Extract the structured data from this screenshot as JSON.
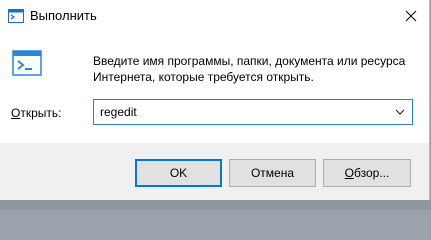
{
  "window": {
    "title": "Выполнить",
    "close_symbol": "✕"
  },
  "dialog": {
    "description_line1": "Введите имя программы, папки, документа или ресурса",
    "description_line2": "Интернета, которые требуется открыть.",
    "open_label_mnemonic": "О",
    "open_label_rest": "ткрыть:",
    "input_value": "regedit"
  },
  "buttons": {
    "ok": "OK",
    "cancel": "Отмена",
    "browse_mnemonic": "О",
    "browse_rest": "бзор..."
  },
  "icons": {
    "title": "run-app-icon",
    "body": "run-app-icon",
    "dropdown": "chevron-down-icon",
    "close": "close-icon"
  },
  "colors": {
    "accent": "#0078d7",
    "footer": "#f0f0f0"
  }
}
